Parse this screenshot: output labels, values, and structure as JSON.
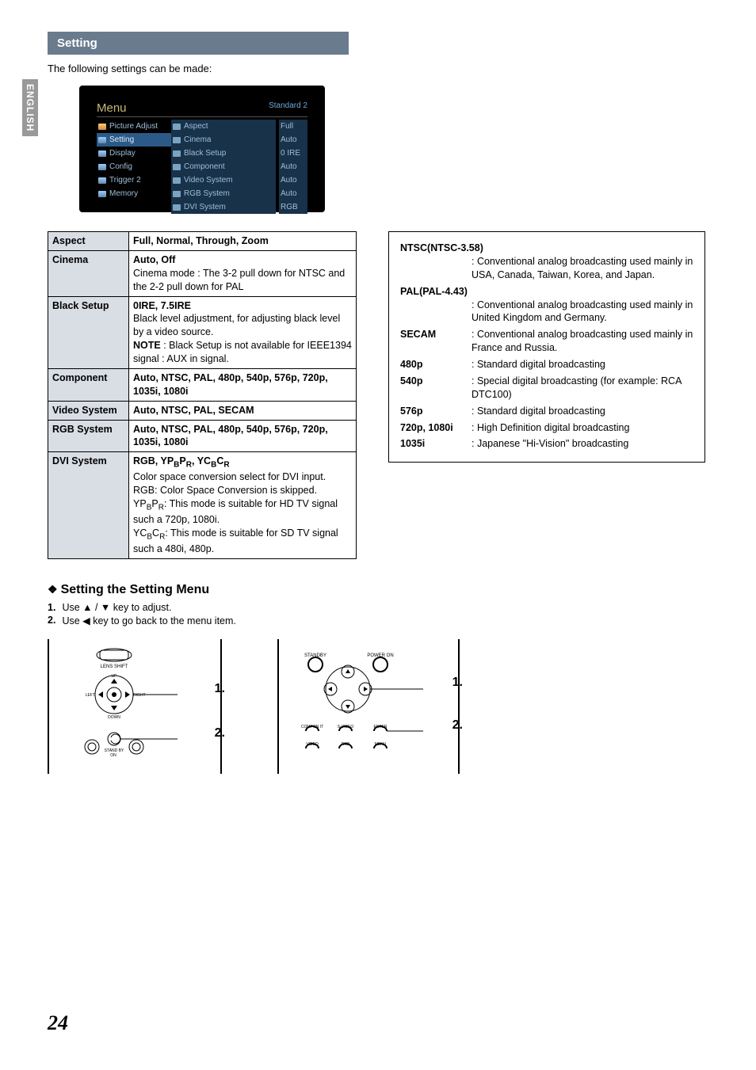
{
  "sideTab": "ENGLISH",
  "headerBar": "Setting",
  "intro": "The following settings can be made:",
  "menu": {
    "title": "Menu",
    "mode": "Standard 2",
    "left": [
      "Picture Adjust",
      "Setting",
      "Display",
      "Config",
      "Trigger 2",
      "Memory"
    ],
    "leftSelectedIndex": 1,
    "mid": [
      "Aspect",
      "Cinema",
      "Black Setup",
      "Component",
      "Video System",
      "RGB System",
      "DVI System"
    ],
    "right": [
      "Full",
      "Auto",
      "0 IRE",
      "Auto",
      "Auto",
      "Auto",
      "RGB"
    ]
  },
  "settingsTable": [
    {
      "k": "Aspect",
      "v": "<span class='b'>Full, Normal, Through, Zoom</span>"
    },
    {
      "k": "Cinema",
      "v": "<span class='b'>Auto, Off</span><br>Cinema mode : The 3-2 pull down for NTSC and the 2-2 pull down for PAL"
    },
    {
      "k": "Black Setup",
      "v": "<span class='b'>0IRE, 7.5IRE</span><br>Black level adjustment, for adjusting black level by a video source.<br><span class='b'>NOTE</span> : Black Setup is not available for IEEE1394 signal : AUX in signal."
    },
    {
      "k": "Component",
      "v": "<span class='b'>Auto, NTSC, PAL, 480p, 540p, 576p, 720p, 1035i, 1080i</span>"
    },
    {
      "k": "Video System",
      "v": "<span class='b'>Auto, NTSC, PAL, SECAM</span>"
    },
    {
      "k": "RGB System",
      "v": "<span class='b'>Auto, NTSC, PAL, 480p, 540p, 576p, 720p, 1035i, 1080i</span>"
    },
    {
      "k": "DVI System",
      "v": "<span class='b'>RGB, YP<span class='sub'>B</span>P<span class='sub'>R</span>, YC<span class='sub'>B</span>C<span class='sub'>R</span></span><br>Color space conversion select for DVI input.<br>RGB: Color Space Conversion is skipped.<br>YP<span class='sub'>B</span>P<span class='sub'>R</span>: This mode is suitable for HD TV signal such a 720p, 1080i.<br>YC<span class='sub'>B</span>C<span class='sub'>R</span>: This mode is suitable for SD TV signal such a 480i, 480p."
    }
  ],
  "formats": {
    "ntscTitle": "NTSC(NTSC-3.58)",
    "ntscDesc": ": Conventional analog broadcasting used mainly in USA, Canada, Taiwan, Korea, and Japan.",
    "palTitle": "PAL(PAL-4.43)",
    "palDesc": ": Conventional analog broadcasting used mainly in United Kingdom and Germany.",
    "rows": [
      {
        "lbl": "SECAM",
        "desc": ": Conventional analog broadcasting used mainly in France and Russia."
      },
      {
        "lbl": "480p",
        "desc": ": Standard digital broadcasting"
      },
      {
        "lbl": "540p",
        "desc": ": Special digital broadcasting (for example: RCA DTC100)"
      },
      {
        "lbl": "576p",
        "desc": ": Standard digital broadcasting"
      },
      {
        "lbl": "720p, 1080i",
        "desc": ": High Definition digital broadcasting"
      },
      {
        "lbl": "1035i",
        "desc": ": Japanese \"Hi-Vision\" broadcasting"
      }
    ]
  },
  "subheading": "Setting the Setting Menu",
  "steps": {
    "s1num": "1.",
    "s1": "Use ▲ / ▼ key to adjust.",
    "s2num": "2.",
    "s2": "Use ◀ key to go back to the menu item."
  },
  "diagramLabels": {
    "one": "1.",
    "two": "2."
  },
  "pageNumber": "24"
}
